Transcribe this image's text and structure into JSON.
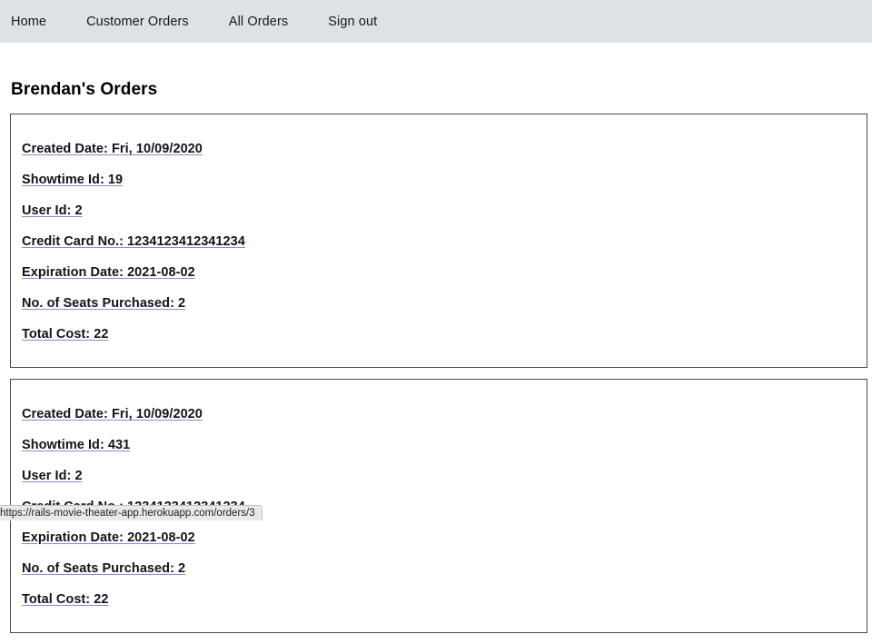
{
  "navbar": {
    "links": [
      {
        "label": "Home"
      },
      {
        "label": "Customer Orders"
      },
      {
        "label": "All Orders"
      },
      {
        "label": "Sign out"
      }
    ]
  },
  "page": {
    "title": "Brendan's Orders"
  },
  "orders": [
    {
      "created_date": "Created Date: Fri, 10/09/2020",
      "showtime_id": "Showtime Id: 19",
      "user_id": "User Id: 2",
      "credit_card": "Credit Card No.: 1234123412341234",
      "expiration_date": "Expiration Date: 2021-08-02",
      "seats": "No. of Seats Purchased: 2",
      "total_cost": "Total Cost: 22"
    },
    {
      "created_date": "Created Date: Fri, 10/09/2020",
      "showtime_id": "Showtime Id: 431",
      "user_id": "User Id: 2",
      "credit_card": "Credit Card No.: 1234123412341234",
      "expiration_date": "Expiration Date: 2021-08-02",
      "seats": "No. of Seats Purchased: 2",
      "total_cost": "Total Cost: 22"
    }
  ],
  "status_bar": {
    "url": "https://rails-movie-theater-app.herokuapp.com/orders/3"
  },
  "colors": {
    "navbar_background": "#dde2e4",
    "card_border": "#4a4a4a",
    "link_underline": "#8a8ad6",
    "text": "#111418",
    "status_bar_background": "#e9e9e9"
  }
}
